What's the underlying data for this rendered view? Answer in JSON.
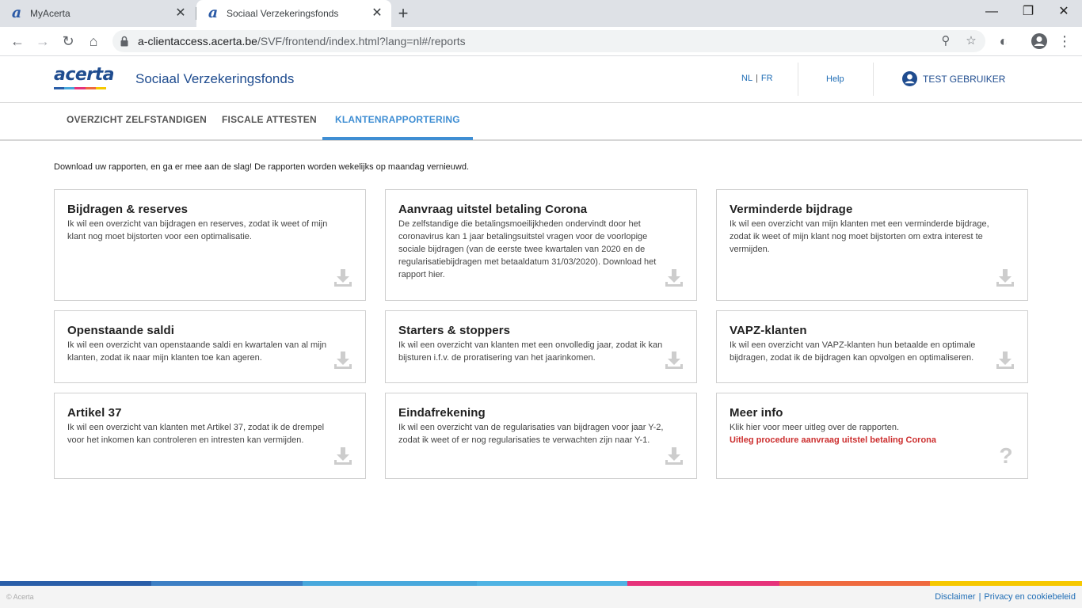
{
  "browser": {
    "tabs": [
      {
        "title": "MyAcerta",
        "favicon": "acerta-a-icon"
      },
      {
        "title": "Sociaal Verzekeringsfonds",
        "favicon": "acerta-a-icon"
      }
    ],
    "url_host": "a-clientaccess.acerta.be",
    "url_path": "/SVF/frontend/index.html?lang=nl#/reports"
  },
  "header": {
    "logo_text": "acerta",
    "title": "Sociaal Verzekeringsfonds",
    "lang_nl": "NL",
    "lang_sep": "|",
    "lang_fr": "FR",
    "help": "Help",
    "user": "TEST GEBRUIKER"
  },
  "nav": {
    "tabs": [
      "OVERZICHT ZELFSTANDIGEN",
      "FISCALE ATTESTEN",
      "KLANTENRAPPORTERING"
    ],
    "active": "KLANTENRAPPORTERING"
  },
  "intro": "Download uw rapporten, en ga er mee aan de slag! De rapporten worden wekelijks op maandag vernieuwd.",
  "cards": [
    {
      "title": "Bijdragen & reserves",
      "text": "Ik wil een overzicht van bijdragen en reserves, zodat ik weet of mijn klant nog moet bijstorten voor een optimalisatie."
    },
    {
      "title": "Aanvraag uitstel betaling Corona",
      "text": "De zelfstandige die betalingsmoeilijkheden ondervindt door het coronavirus kan 1 jaar betalingsuitstel vragen voor de voorlopige sociale bijdragen (van de eerste twee kwartalen van 2020 en de regularisatiebijdragen met betaaldatum 31/03/2020). Download het rapport hier."
    },
    {
      "title": "Verminderde bijdrage",
      "text": "Ik wil een overzicht van mijn klanten met een verminderde bijdrage, zodat ik weet of mijn klant nog moet bijstorten om extra interest te vermijden."
    },
    {
      "title": "Openstaande saldi",
      "text": "Ik wil een overzicht van openstaande saldi en kwartalen van al mijn klanten, zodat ik naar mijn klanten toe kan ageren."
    },
    {
      "title": "Starters & stoppers",
      "text": "Ik wil een overzicht van klanten met een onvolledig jaar, zodat ik kan bijsturen i.f.v. de proratisering van het jaarinkomen."
    },
    {
      "title": "VAPZ-klanten",
      "text": "Ik wil een overzicht van VAPZ-klanten hun betaalde en optimale bijdragen, zodat ik de bijdragen kan opvolgen en optimaliseren."
    },
    {
      "title": "Artikel 37",
      "text": "Ik wil een overzicht van klanten met Artikel 37, zodat ik de drempel voor het inkomen kan controleren en intresten kan vermijden."
    },
    {
      "title": "Eindafrekening",
      "text": "Ik wil een overzicht van de regularisaties van bijdragen voor jaar Y-2, zodat ik weet of er nog regularisaties te verwachten zijn naar Y-1."
    },
    {
      "title": "Meer info",
      "text": "Klik hier voor meer uitleg over de rapporten.",
      "link": "Uitleg procedure aanvraag uitstel betaling Corona"
    }
  ],
  "footer": {
    "copyright": "© Acerta",
    "disclaimer": "Disclaimer",
    "sep": "|",
    "privacy": "Privacy en cookiebeleid"
  },
  "colors": {
    "brand_blue": "#1f4c8f",
    "active_tab": "#3f8ed3",
    "link_red": "#cc2e2e",
    "stripe": [
      "#2a5ea8",
      "#3d7fc4",
      "#48a8dc",
      "#4fb3e3",
      "#e6337a",
      "#ef6a3f",
      "#f6c800"
    ]
  }
}
